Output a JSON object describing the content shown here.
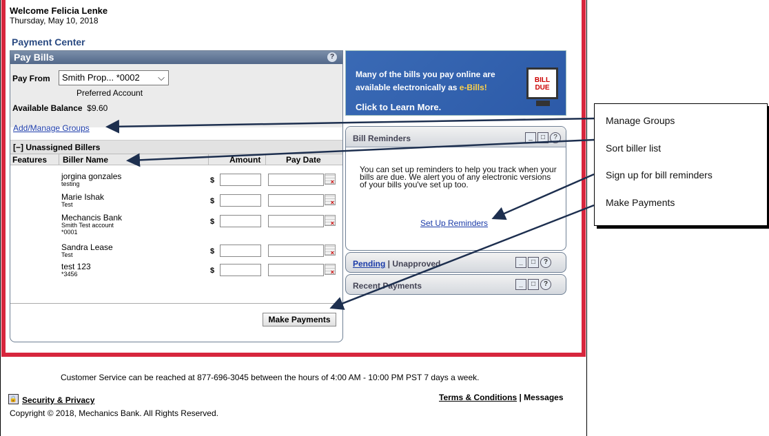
{
  "header": {
    "welcome": "Welcome Felicia Lenke",
    "date": "Thursday, May 10, 2018",
    "section_title": "Payment Center"
  },
  "pay_bills": {
    "title": "Pay Bills",
    "help": "?",
    "pay_from_label": "Pay From",
    "pay_from_value": "Smith Prop... *0002",
    "preferred": "Preferred Account",
    "available_label": "Available Balance",
    "available_value": "$9.60",
    "groups_link": "Add/Manage Groups",
    "unassigned": "[−]  Unassigned Billers",
    "columns": {
      "features": "Features",
      "biller": "Biller Name",
      "amount": "Amount",
      "pay_date": "Pay Date"
    },
    "billers": [
      {
        "name": "jorgina gonzales",
        "sub": "testing",
        "sub2": ""
      },
      {
        "name": "Marie Ishak",
        "sub": "Test",
        "sub2": ""
      },
      {
        "name": "Mechancis Bank",
        "sub": "Smith Test account",
        "sub2": "*0001"
      },
      {
        "name": "Sandra Lease",
        "sub": "Test",
        "sub2": ""
      },
      {
        "name": "test 123",
        "sub": "*3456",
        "sub2": ""
      }
    ],
    "currency": "$",
    "make_payments": "Make Payments"
  },
  "ebill": {
    "line1": "Many of the bills you pay online are",
    "line2_prefix": "available electronically as ",
    "line2_em": "e-Bills!",
    "cta": "Click to Learn More.",
    "badge": "BILL DUE"
  },
  "reminders": {
    "title": "Bill Reminders",
    "body": "You can set up reminders to help you track when your bills are due. We alert you of any electronic versions of your bills you've set up too.",
    "link": "Set Up Reminders"
  },
  "pending": {
    "link": "Pending",
    "sep": " | ",
    "rest": "Unapproved"
  },
  "recent": {
    "title": "Recent Payments"
  },
  "footer": {
    "customer_service": "Customer Service can be reached at 877-696-3045 between the hours of 4:00 AM - 10:00 PM PST 7 days a week.",
    "security": "Security & Privacy",
    "terms": "Terms & Conditions",
    "messages": " | Messages",
    "copyright": "Copyright © 2018, Mechanics Bank. All Rights Reserved."
  },
  "annotations": [
    "Manage Groups",
    "Sort biller list",
    "Sign up for bill reminders",
    "Make Payments"
  ],
  "colors": {
    "frame_red": "#d7263d",
    "header_blue": "#2a4a82",
    "link_blue": "#1a3aa8"
  }
}
